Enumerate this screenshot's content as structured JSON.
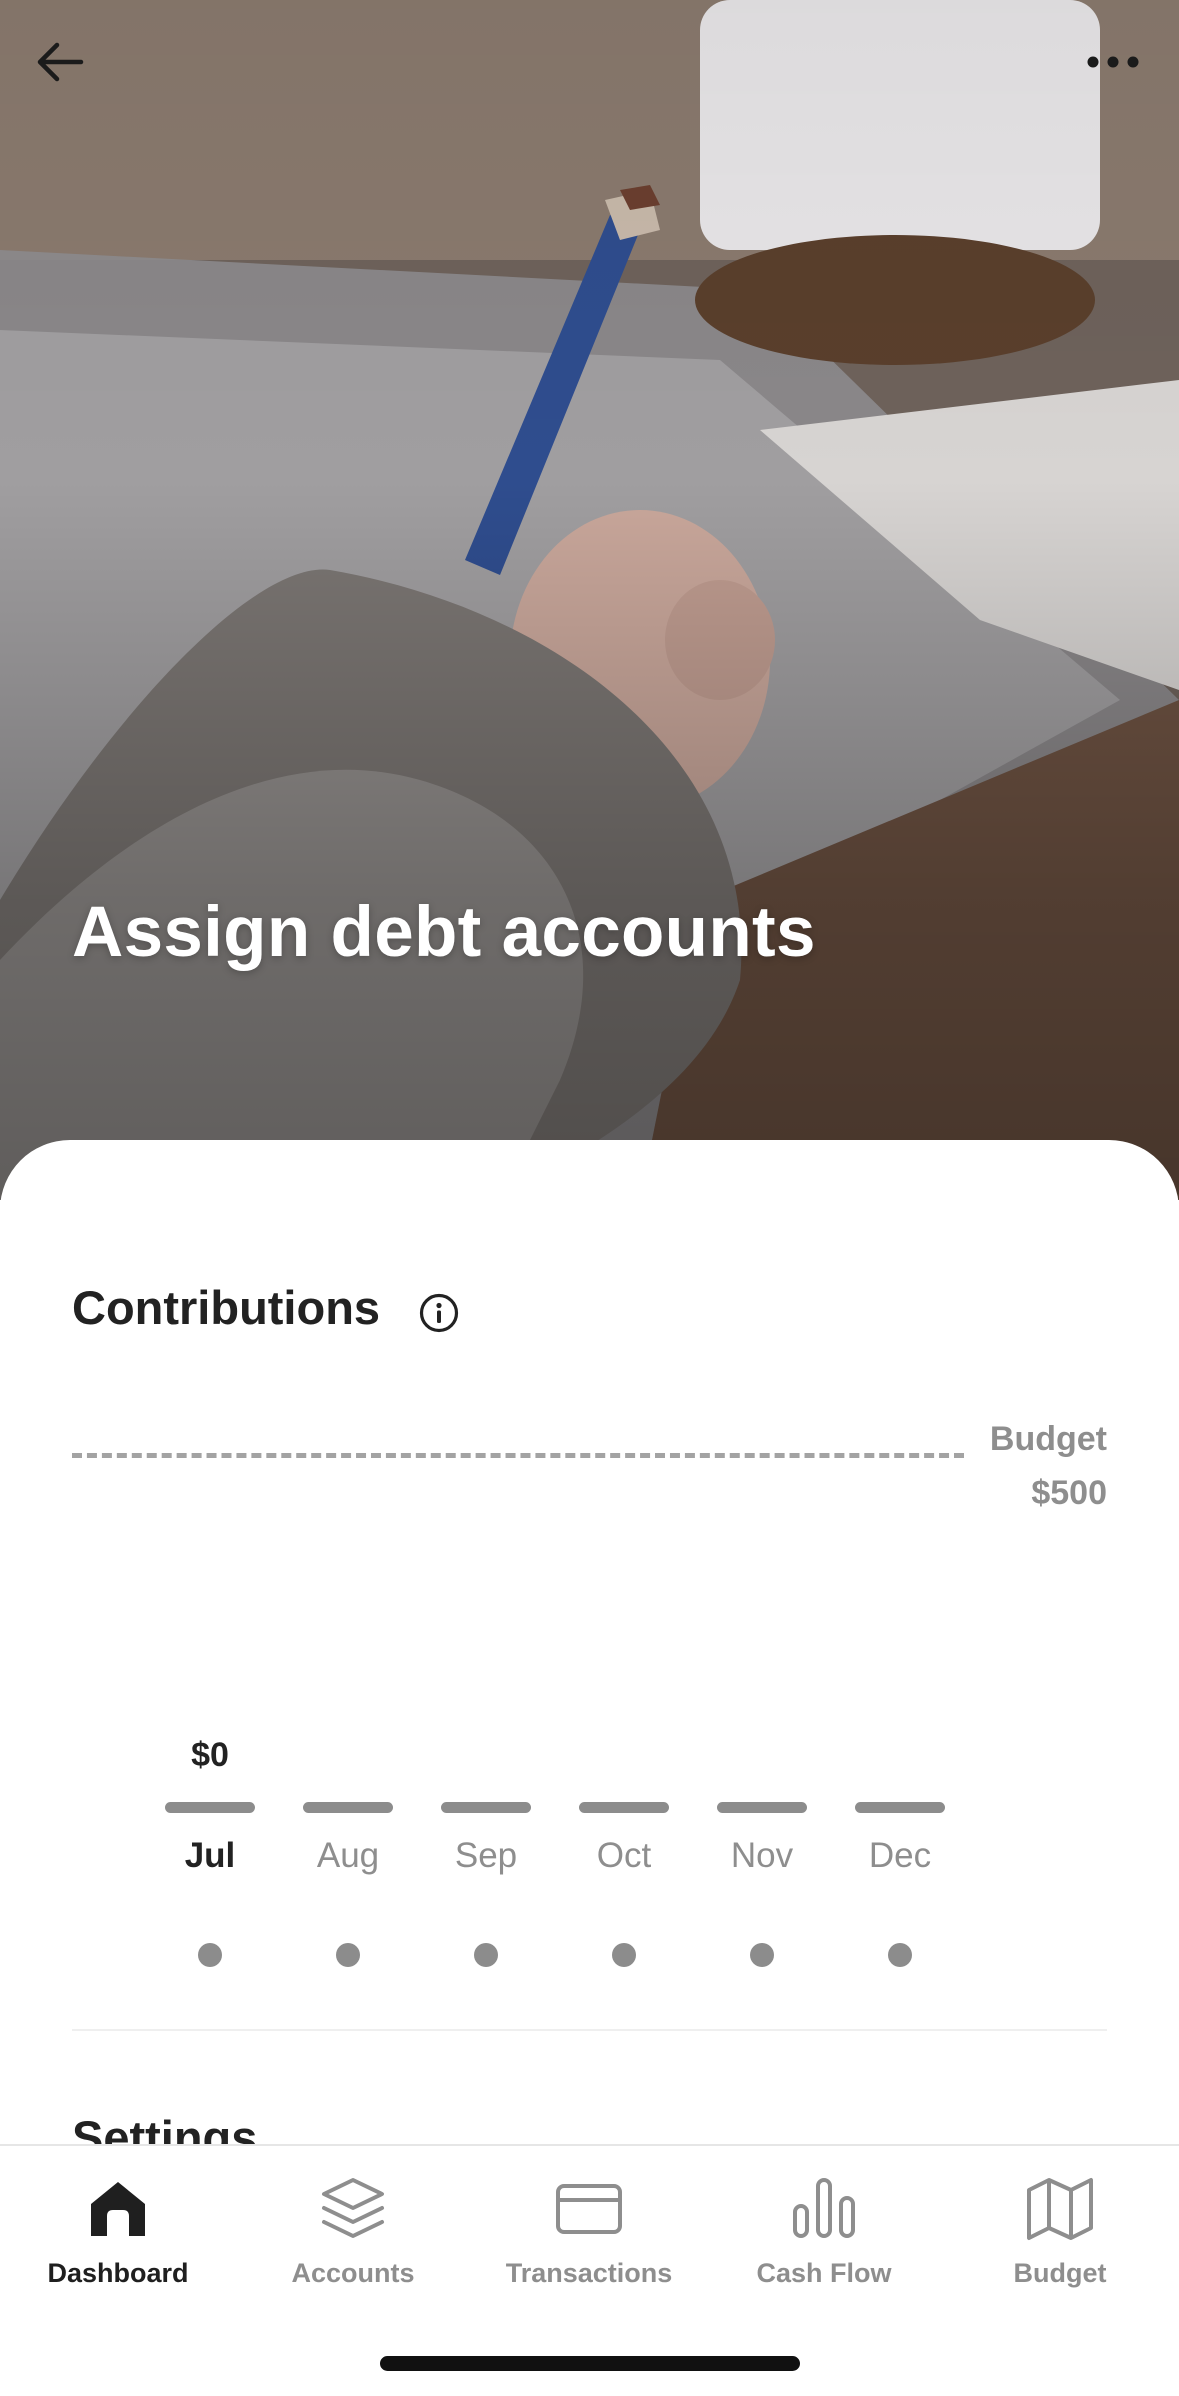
{
  "header": {
    "title": "Assign debt accounts",
    "back_icon": "arrow-left-icon",
    "more_icon": "more-horizontal-icon"
  },
  "contributions": {
    "title": "Contributions",
    "info_icon": "info-icon",
    "budget_label": "Budget",
    "budget_value": "$500",
    "current_value": "$0",
    "months": [
      "Jul",
      "Aug",
      "Sep",
      "Oct",
      "Nov",
      "Dec"
    ],
    "active_month": "Jul"
  },
  "settings": {
    "title": "Settings"
  },
  "tabbar": {
    "items": [
      {
        "label": "Dashboard",
        "icon": "home-icon",
        "active": true
      },
      {
        "label": "Accounts",
        "icon": "layers-icon",
        "active": false
      },
      {
        "label": "Transactions",
        "icon": "credit-card-icon",
        "active": false
      },
      {
        "label": "Cash Flow",
        "icon": "bar-chart-icon",
        "active": false
      },
      {
        "label": "Budget",
        "icon": "map-icon",
        "active": false
      }
    ]
  },
  "colors": {
    "text_primary": "#222222",
    "text_muted": "#8e8e8e",
    "bar": "#8c8c8c"
  }
}
